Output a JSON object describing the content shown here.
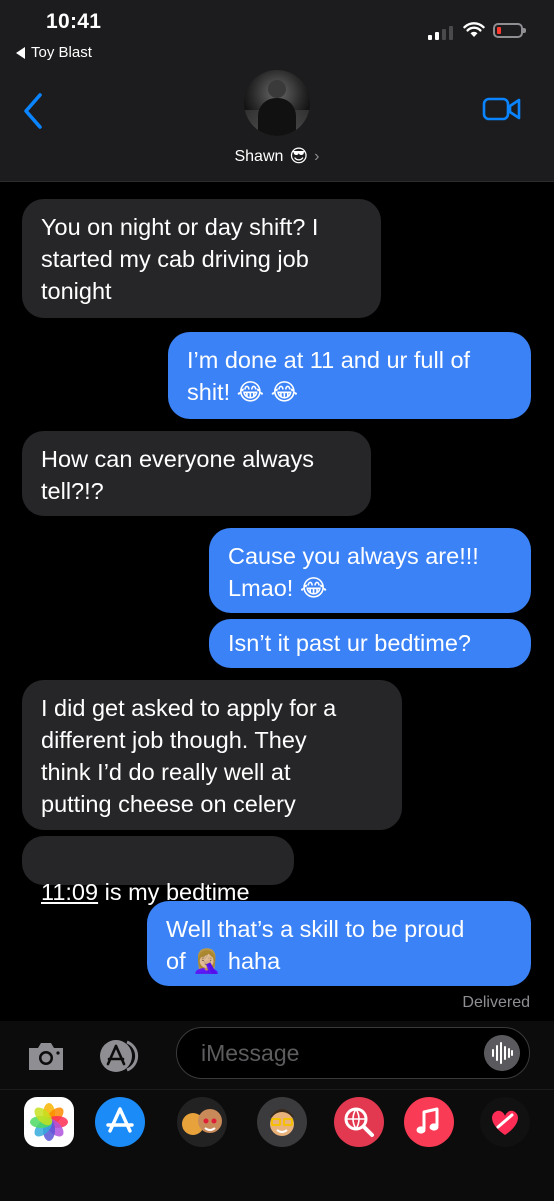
{
  "status_bar": {
    "time": "10:41",
    "back_app": "Toy Blast",
    "battery_color": "#ff3b30"
  },
  "header": {
    "contact_name": "Shawn",
    "contact_emoji": "😎",
    "chevron": "›",
    "icons": [
      "back-chevron-icon",
      "facetime-video-icon"
    ]
  },
  "messages": [
    {
      "direction": "incoming",
      "text": "You on night or day shift? I\nstarted my cab driving job\ntonight"
    },
    {
      "direction": "outgoing",
      "text": "I’m done at 11 and ur full of\nshit! 😂 😂"
    },
    {
      "direction": "incoming",
      "text": "How can everyone always\ntell?!?"
    },
    {
      "direction": "outgoing",
      "text": "Cause you always are!!!\nLmao! 😂"
    },
    {
      "direction": "outgoing",
      "text": "Isn’t it past ur bedtime?"
    },
    {
      "direction": "incoming",
      "text": "I did get asked to apply for a\ndifferent job though. They\nthink I’d do really well at\nputting cheese on celery"
    },
    {
      "direction": "incoming",
      "time_link": "11:09",
      "text": " is my bedtime"
    },
    {
      "direction": "outgoing",
      "text": "Well that’s a skill to be proud\nof 🤦🏼‍♀️ haha"
    }
  ],
  "delivered": "Delivered",
  "input": {
    "placeholder": "iMessage",
    "icons": [
      "camera-icon",
      "app-store-icon",
      "audio-waveform-icon"
    ]
  },
  "drawer_apps": [
    {
      "name": "Photos"
    },
    {
      "name": "App Store"
    },
    {
      "name": "Stickers"
    },
    {
      "name": "Memoji"
    },
    {
      "name": "Web Search"
    },
    {
      "name": "Music"
    },
    {
      "name": "Digital Touch"
    }
  ],
  "colors": {
    "incoming_bubble": "#262629",
    "outgoing_bubble": "#3b82f7",
    "accent": "#0a84ff"
  }
}
